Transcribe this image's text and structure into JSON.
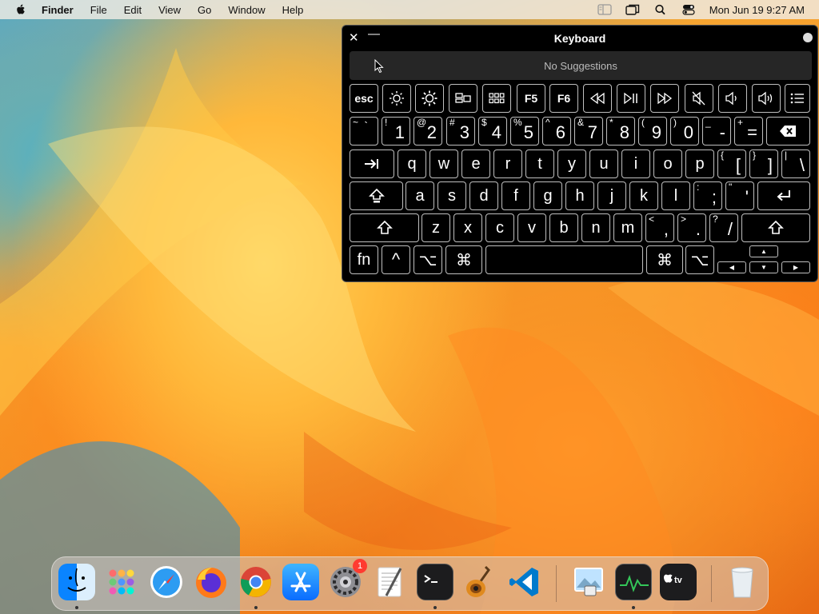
{
  "menubar": {
    "app": "Finder",
    "items": [
      "File",
      "Edit",
      "View",
      "Go",
      "Window",
      "Help"
    ],
    "clock": "Mon Jun 19  9:27 AM"
  },
  "keyboard": {
    "title": "Keyboard",
    "close": "✕",
    "minimize": "—",
    "suggestions": "No Suggestions",
    "fn_row": [
      "esc",
      "",
      "",
      "",
      "",
      "F5",
      "F6",
      "",
      "",
      "",
      "",
      "",
      "",
      ""
    ],
    "number_row": [
      {
        "s": "~",
        "m": "`"
      },
      {
        "s": "!",
        "m": "1"
      },
      {
        "s": "@",
        "m": "2"
      },
      {
        "s": "#",
        "m": "3"
      },
      {
        "s": "$",
        "m": "4"
      },
      {
        "s": "%",
        "m": "5"
      },
      {
        "s": "^",
        "m": "6"
      },
      {
        "s": "&",
        "m": "7"
      },
      {
        "s": "*",
        "m": "8"
      },
      {
        "s": "(",
        "m": "9"
      },
      {
        "s": ")",
        "m": "0"
      },
      {
        "s": "_",
        "m": "-"
      },
      {
        "s": "+",
        "m": "="
      }
    ],
    "qwerty_row": [
      "q",
      "w",
      "e",
      "r",
      "t",
      "y",
      "u",
      "i",
      "o",
      "p"
    ],
    "qwerty_extra": [
      {
        "s": "{",
        "m": "["
      },
      {
        "s": "}",
        "m": "]"
      },
      {
        "s": "|",
        "m": "\\"
      }
    ],
    "asdf_row": [
      "a",
      "s",
      "d",
      "f",
      "g",
      "h",
      "j",
      "k",
      "l"
    ],
    "asdf_extra": [
      {
        "s": ":",
        "m": ";"
      },
      {
        "s": "\"",
        "m": "'"
      }
    ],
    "zxcv_row": [
      "z",
      "x",
      "c",
      "v",
      "b",
      "n",
      "m"
    ],
    "zxcv_extra": [
      {
        "s": "<",
        "m": ","
      },
      {
        "s": ">",
        "m": "."
      },
      {
        "s": "?",
        "m": "/"
      }
    ],
    "bottom": {
      "fn": "fn",
      "control": "^",
      "option": "⌥",
      "command": "⌘",
      "command_r": "⌘",
      "option_r": "⌥"
    },
    "arrows": {
      "up": "▲",
      "left": "◀",
      "down": "▼",
      "right": "▶"
    }
  },
  "dock": {
    "apps": [
      "finder",
      "launchpad",
      "safari",
      "firefox",
      "chrome",
      "app-store",
      "system-settings",
      "textedit",
      "terminal",
      "garageband",
      "vscode",
      "preview",
      "activity-monitor",
      "apple-tv",
      "trash"
    ],
    "settings_badge": "1"
  }
}
